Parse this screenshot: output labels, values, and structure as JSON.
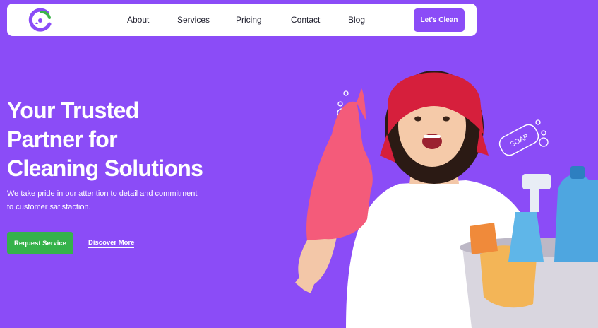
{
  "nav": {
    "links": [
      {
        "label": "About"
      },
      {
        "label": "Services"
      },
      {
        "label": "Pricing"
      },
      {
        "label": "Contact"
      },
      {
        "label": "Blog"
      }
    ],
    "cta_label": "Let's Clean"
  },
  "hero": {
    "title_line1": "Your Trusted",
    "title_line2": "Partner for",
    "title_line3": "Cleaning Solutions",
    "subtitle": "We take pride in our attention to detail and commitment to customer satisfaction.",
    "primary_button": "Request Service",
    "secondary_link": "Discover More"
  },
  "illustration": {
    "soap_label": "SOAP"
  },
  "colors": {
    "background": "#8b4cf7",
    "primary_button": "#35b24a",
    "nav_bg": "#ffffff",
    "logo_green": "#3db34a",
    "logo_purple": "#8b4cf7"
  }
}
